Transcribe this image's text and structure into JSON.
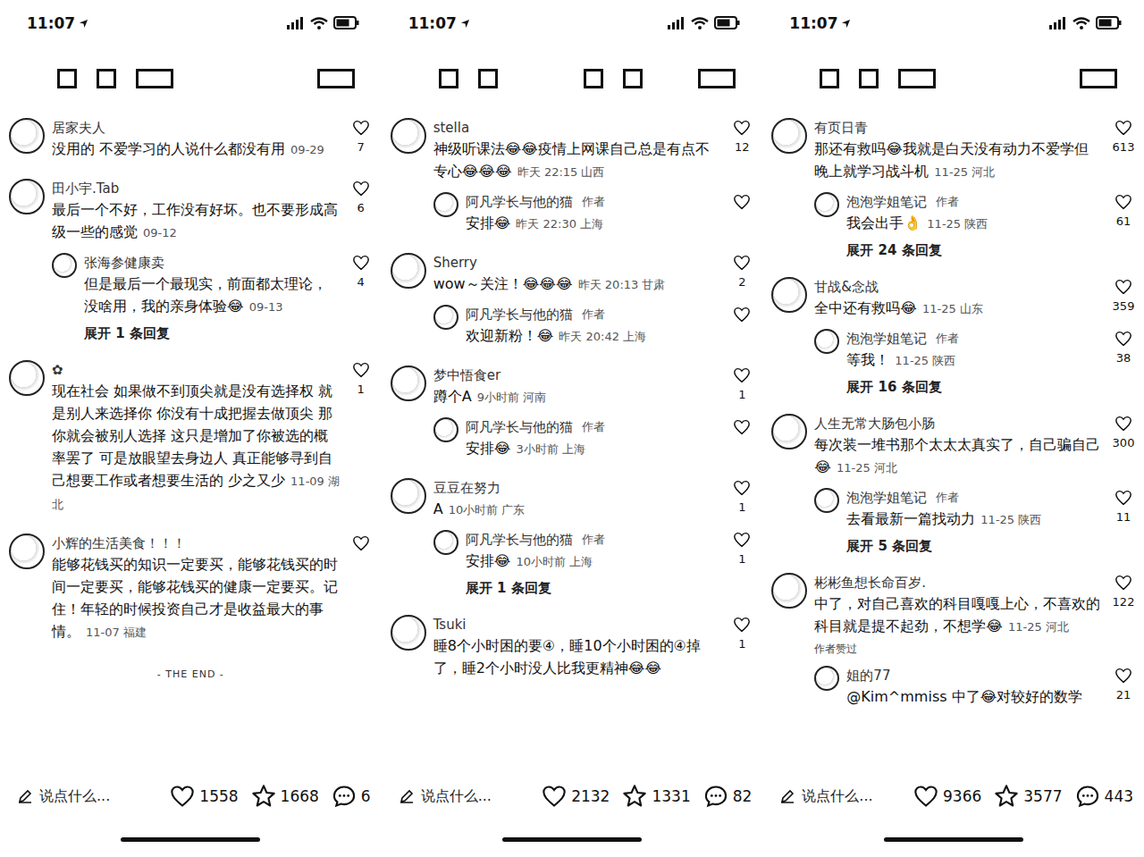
{
  "panels": [
    {
      "status": {
        "time": "11:07"
      },
      "header": {
        "left": [
          "box",
          "box",
          "wide"
        ],
        "right": [
          "wide"
        ]
      },
      "comments": [
        {
          "name": "居家夫人",
          "text": "没用的 不爱学习的人说什么都没有用",
          "meta": "09-29",
          "likes": "7",
          "badge": "",
          "replies": [],
          "expand": ""
        },
        {
          "name": "田小宇.Tab",
          "text": "最后一个不好，工作没有好坏。也不要形成高级一些的感觉",
          "meta": "09-12",
          "likes": "6",
          "badge": "",
          "replies": [
            {
              "name": "张海参健康卖",
              "author_badge": "",
              "text": "但是最后一个最现实，前面都太理论，没啥用，我的亲身体验😂",
              "meta": "09-13",
              "likes": "4"
            }
          ],
          "expand": "展开 1 条回复"
        },
        {
          "name": "✿",
          "text": "现在社会 如果做不到顶尖就是没有选择权 就是别人来选择你 你没有十成把握去做顶尖 那你就会被别人选择 这只是增加了你被选的概率罢了 可是放眼望去身边人 真正能够寻到自己想要工作或者想要生活的 少之又少",
          "meta": "11-09 湖北",
          "likes": "1",
          "badge": "",
          "replies": [],
          "expand": ""
        },
        {
          "name": "小辉的生活美食！！！",
          "text": "能够花钱买的知识一定要买，能够花钱买的时间一定要买，能够花钱买的健康一定要买。记住！年轻的时候投资自己才是收益最大的事情。",
          "meta": "11-07 福建",
          "likes": "",
          "badge": "",
          "replies": [],
          "expand": ""
        }
      ],
      "end_text": "- THE END -",
      "bottom": {
        "placeholder": "说点什么...",
        "likes": "1558",
        "stars": "1668",
        "comments": "6"
      }
    },
    {
      "status": {
        "time": "11:07"
      },
      "header": {
        "left": [
          "box",
          "box",
          "gap",
          "box",
          "box"
        ],
        "right": [
          "wide"
        ]
      },
      "comments": [
        {
          "name": "stella",
          "text": "神级听课法😂😂疫情上网课自己总是有点不专心😂😂😂",
          "meta": "昨天 22:15 山西",
          "likes": "12",
          "badge": "",
          "replies": [
            {
              "name": "阿凡学长与他的猫",
              "author_badge": "作者",
              "text": "安排😂",
              "meta": "昨天 22:30 上海",
              "likes": ""
            }
          ],
          "expand": ""
        },
        {
          "name": "Sherry",
          "text": "wow～关注！😂😂😂",
          "meta": "昨天 20:13 甘肃",
          "likes": "2",
          "badge": "",
          "replies": [
            {
              "name": "阿凡学长与他的猫",
              "author_badge": "作者",
              "text": "欢迎新粉！😂",
              "meta": "昨天 20:42 上海",
              "likes": ""
            }
          ],
          "expand": ""
        },
        {
          "name": "梦中悟食er",
          "text": "蹲个A",
          "meta": "9小时前 河南",
          "likes": "1",
          "badge": "",
          "replies": [
            {
              "name": "阿凡学长与他的猫",
              "author_badge": "作者",
              "text": "安排😂",
              "meta": "3小时前 上海",
              "likes": ""
            }
          ],
          "expand": ""
        },
        {
          "name": "豆豆在努力",
          "text": "A",
          "meta": "10小时前 广东",
          "likes": "1",
          "badge": "",
          "replies": [
            {
              "name": "阿凡学长与他的猫",
              "author_badge": "作者",
              "text": "安排😂",
              "meta": "10小时前 上海",
              "likes": "1"
            }
          ],
          "expand": "展开 1 条回复"
        },
        {
          "name": "Tsuki",
          "text": "睡8个小时困的要④，睡10个小时困的④掉了，睡2个小时没人比我更精神😂😂",
          "meta": "",
          "likes": "1",
          "badge": "",
          "replies": [],
          "expand": ""
        }
      ],
      "end_text": "",
      "bottom": {
        "placeholder": "说点什么...",
        "likes": "2132",
        "stars": "1331",
        "comments": "82"
      }
    },
    {
      "status": {
        "time": "11:07"
      },
      "header": {
        "left": [
          "box",
          "box",
          "wide"
        ],
        "right": [
          "wide"
        ]
      },
      "comments": [
        {
          "name": "有页日青",
          "text": "那还有救吗😂我就是白天没有动力不爱学但晚上就学习战斗机",
          "meta": "11-25 河北",
          "likes": "613",
          "badge": "",
          "replies": [
            {
              "name": "泡泡学姐笔记",
              "author_badge": "作者",
              "text": "我会出手👌",
              "meta": "11-25 陕西",
              "likes": "61"
            }
          ],
          "expand": "展开 24 条回复"
        },
        {
          "name": "甘战&念战",
          "text": "全中还有救吗😂",
          "meta": "11-25 山东",
          "likes": "359",
          "badge": "",
          "replies": [
            {
              "name": "泡泡学姐笔记",
              "author_badge": "作者",
              "text": "等我！",
              "meta": "11-25 陕西",
              "likes": "38"
            }
          ],
          "expand": "展开 16 条回复"
        },
        {
          "name": "人生无常大肠包小肠",
          "text": "每次装一堆书那个太太太真实了，自己骗自己😂",
          "meta": "11-25 河北",
          "likes": "300",
          "badge": "",
          "replies": [
            {
              "name": "泡泡学姐笔记",
              "author_badge": "作者",
              "text": "去看最新一篇找动力",
              "meta": "11-25 陕西",
              "likes": "11"
            }
          ],
          "expand": "展开 5 条回复"
        },
        {
          "name": "彬彬鱼想长命百岁.",
          "text": "中了，对自己喜欢的科目嘎嘎上心，不喜欢的科目就是提不起劲，不想学😂",
          "meta": "11-25 河北",
          "likes": "122",
          "badge": "作者赞过",
          "replies": [
            {
              "name": "姐的77",
              "author_badge": "",
              "text": "@Kim^mmiss 中了😂对较好的数学",
              "meta": "",
              "likes": "21"
            }
          ],
          "expand": ""
        }
      ],
      "end_text": "",
      "bottom": {
        "placeholder": "说点什么...",
        "likes": "9366",
        "stars": "3577",
        "comments": "443"
      }
    }
  ]
}
